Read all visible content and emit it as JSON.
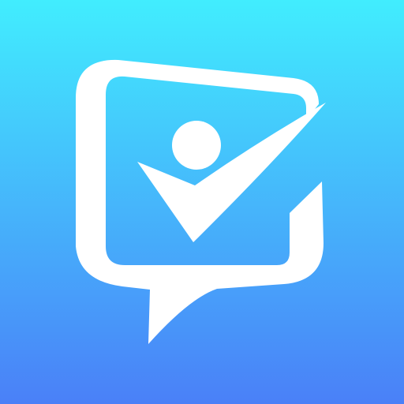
{
  "icon": {
    "name": "chat-checkmark-person-icon",
    "gradient_top": "#41edfe",
    "gradient_bottom": "#4a80f8",
    "glyph_color": "#ffffff"
  }
}
